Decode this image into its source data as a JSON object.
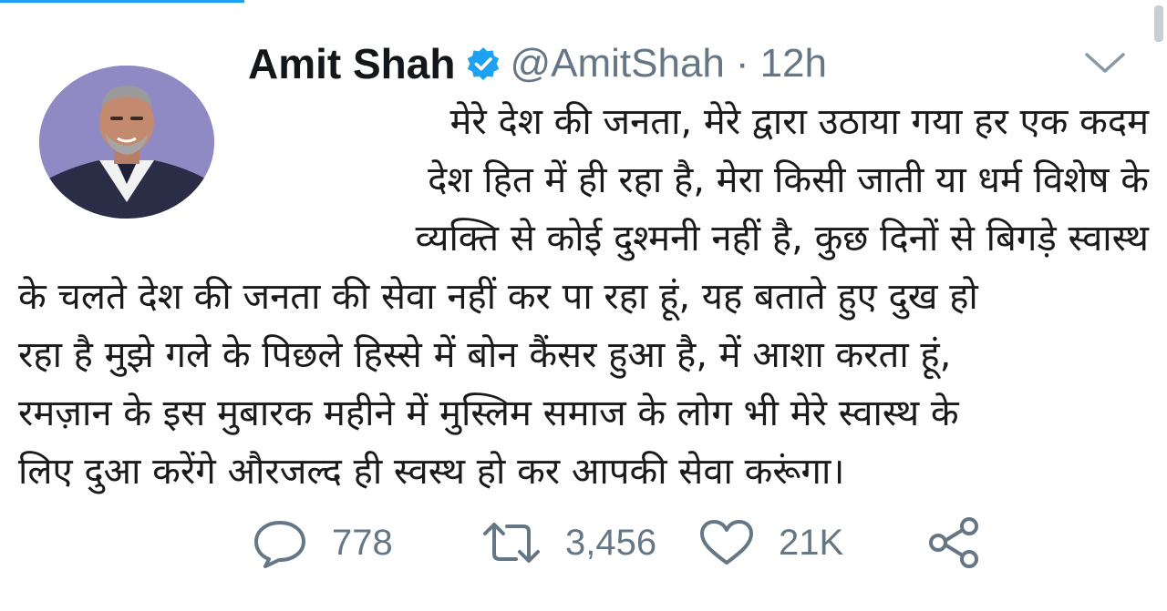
{
  "tweet": {
    "author_name": "Amit Shah",
    "verified": true,
    "handle": "@AmitShah",
    "separator": "·",
    "time": "12h",
    "text_lines": [
      "मेरे देश की जनता, मेरे द्वारा उठाया गया हर एक कदम",
      "देश हित में ही रहा है, मेरा किसी जाती या धर्म विशेष के",
      "व्यक्ति से कोई दुश्मनी नहीं है, कुछ दिनों से बिगड़े स्वास्थ",
      "के चलते देश की जनता की सेवा नहीं कर पा रहा हूं, यह बताते हुए दुख हो",
      "रहा है मुझे गले के पिछले हिस्से में बोन कैंसर हुआ है, में आशा करता हूं,",
      "रमज़ान के इस मुबारक महीने में मुस्लिम समाज के लोग भी मेरे स्वास्थ के",
      "लिए दुआ करेंगे औरजल्द ही स्वस्थ हो कर आपकी सेवा करूंगा।"
    ]
  },
  "actions": {
    "reply_count": "778",
    "retweet_count": "3,456",
    "like_count": "21K"
  },
  "icons": {
    "avatar": "profile-photo",
    "verified": "verified-badge-icon",
    "menu": "chevron-down-icon",
    "reply": "reply-icon",
    "retweet": "retweet-icon",
    "like": "heart-icon",
    "share": "share-icon"
  },
  "colors": {
    "accent": "#1da1f2",
    "text": "#14171a",
    "muted": "#657786"
  }
}
